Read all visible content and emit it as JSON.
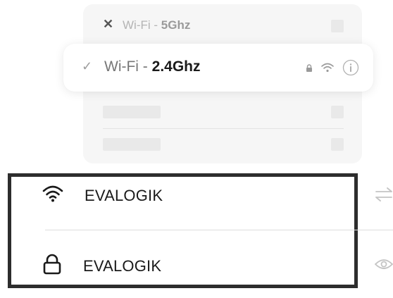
{
  "back_card": {
    "close_glyph": "✕",
    "network_prefix": "Wi-Fi - ",
    "network_band": "5Ghz"
  },
  "front_card": {
    "check_glyph": "✓",
    "network_prefix": "Wi-Fi - ",
    "network_band": "2.4Ghz",
    "icons": [
      "lock-icon",
      "wifi-icon",
      "info-icon"
    ]
  },
  "highlight": {
    "rows": [
      {
        "icon": "wifi-icon",
        "label": "EVALOGIK",
        "side_icon": "swap-arrows-icon"
      },
      {
        "icon": "lock-icon",
        "label": "EVALOGIK",
        "side_icon": "eye-icon"
      }
    ]
  },
  "colors": {
    "border": "#2d2d2d",
    "card_bg": "#f6f6f6",
    "placeholder": "#e9e9e9",
    "text_dark": "#1a1a1a"
  }
}
